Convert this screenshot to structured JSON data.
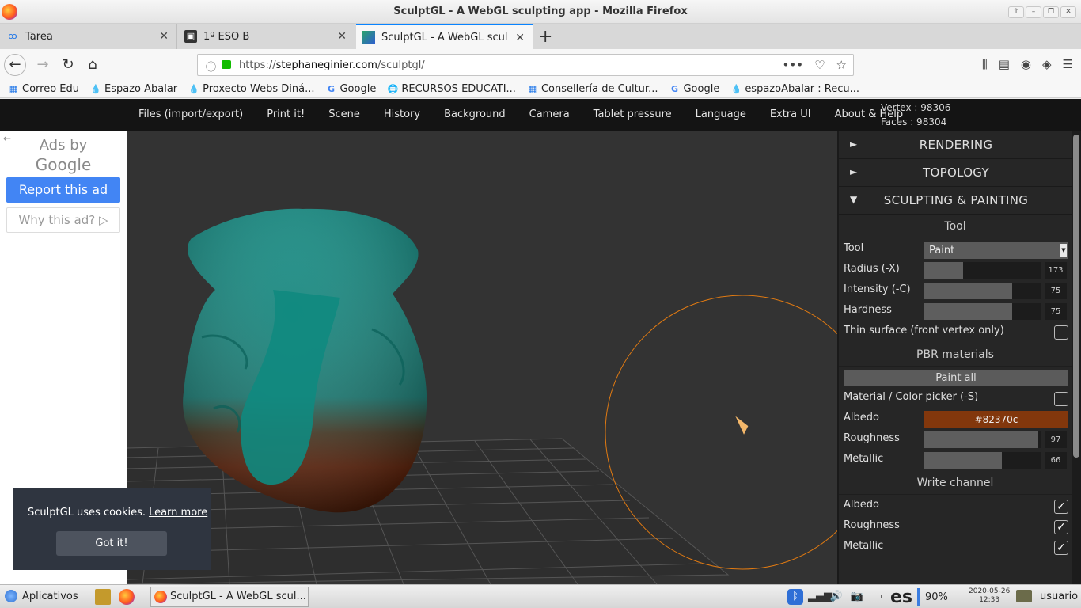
{
  "window": {
    "title": "SculptGL - A WebGL sculpting app - Mozilla Firefox"
  },
  "tabs": [
    {
      "label": "Tarea",
      "icon": "classroom-icon"
    },
    {
      "label": "1º ESO B",
      "icon": "classroom-icon"
    },
    {
      "label": "SculptGL - A WebGL sculp",
      "icon": "sculptgl-icon",
      "active": true
    }
  ],
  "urlbar": {
    "prefix": "https://",
    "domain": "stephaneginier.com",
    "path": "/sculptgl/"
  },
  "bookmarks": [
    {
      "label": "Correo Edu",
      "icon": "edu-icon"
    },
    {
      "label": "Espazo Abalar",
      "icon": "drupal-icon"
    },
    {
      "label": "Proxecto Webs Diná...",
      "icon": "drupal-icon"
    },
    {
      "label": "Google",
      "icon": "google-icon"
    },
    {
      "label": "RECURSOS EDUCATI...",
      "icon": "globe-icon"
    },
    {
      "label": "Consellería de Cultur...",
      "icon": "xunta-icon"
    },
    {
      "label": "Google",
      "icon": "google-icon"
    },
    {
      "label": "espazoAbalar : Recu...",
      "icon": "drupal-icon"
    }
  ],
  "appmenu": [
    "Files (import/export)",
    "Print it!",
    "Scene",
    "History",
    "Background",
    "Camera",
    "Tablet pressure",
    "Language",
    "Extra UI",
    "About & Help"
  ],
  "stats": {
    "vertex": "Vertex : 98306",
    "faces": "Faces : 98304"
  },
  "ad": {
    "title_line1": "Ads by",
    "title_line2": "Google",
    "report": "Report this ad",
    "why": "Why this ad? ▷"
  },
  "cookie": {
    "text": "SculptGL uses cookies.",
    "link": "Learn more",
    "button": "Got it!"
  },
  "panel": {
    "sections": [
      {
        "label": "RENDERING",
        "arrow": "►"
      },
      {
        "label": "TOPOLOGY",
        "arrow": "►"
      },
      {
        "label": "SCULPTING & PAINTING",
        "arrow": "▼"
      }
    ],
    "tool_header": "Tool",
    "tool_label": "Tool",
    "tool_value": "Paint",
    "radius": {
      "label": "Radius (-X)",
      "value": "173",
      "fraction": 0.33
    },
    "intensity": {
      "label": "Intensity (-C)",
      "value": "75",
      "fraction": 0.75
    },
    "hardness": {
      "label": "Hardness",
      "value": "75",
      "fraction": 0.75
    },
    "thin_surface": "Thin surface (front vertex only)",
    "pbr_header": "PBR materials",
    "paint_all": "Paint all",
    "color_picker": "Material / Color picker (-S)",
    "albedo": {
      "label": "Albedo",
      "value": "#82370c"
    },
    "roughness": {
      "label": "Roughness",
      "value": "97",
      "fraction": 0.97
    },
    "metallic": {
      "label": "Metallic",
      "value": "66",
      "fraction": 0.66
    },
    "write_header": "Write channel",
    "write": [
      {
        "label": "Albedo",
        "check": "✓"
      },
      {
        "label": "Roughness",
        "check": "✓"
      },
      {
        "label": "Metallic",
        "check": "✓"
      }
    ]
  },
  "taskbar": {
    "apps": "Aplicativos",
    "window": "SculptGL - A WebGL scul...",
    "lang": "es",
    "battery": "90%",
    "date": "2020-05-26",
    "time": "12:33",
    "user": "usuario"
  }
}
